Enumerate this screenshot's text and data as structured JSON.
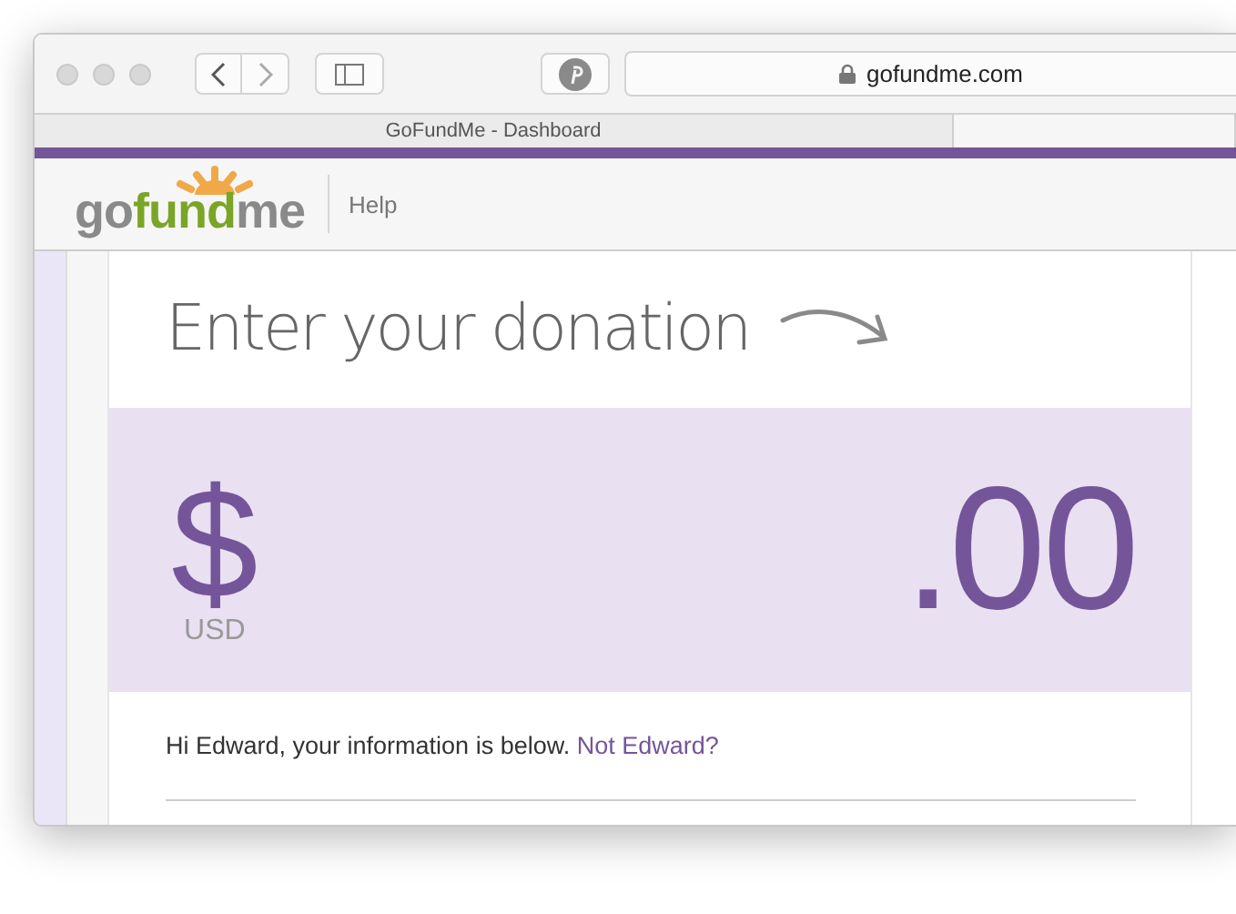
{
  "browser": {
    "address": "gofundme.com",
    "tabs": [
      {
        "title": "GoFundMe - Dashboard",
        "selected": true
      },
      {
        "selected": false
      }
    ]
  },
  "header": {
    "logo": [
      {
        "text": "go",
        "color": "#8a8a8a"
      },
      {
        "text": "fund",
        "color": "#7aa528"
      },
      {
        "text": "me",
        "color": "#8a8a8a"
      }
    ],
    "help": "Help"
  },
  "donation": {
    "heading": "Enter your donation",
    "currency_symbol": "$",
    "currency_code": "USD",
    "amount": ".00"
  },
  "greeting": {
    "text": "Hi Edward, your information is below.",
    "link": "Not Edward?"
  }
}
